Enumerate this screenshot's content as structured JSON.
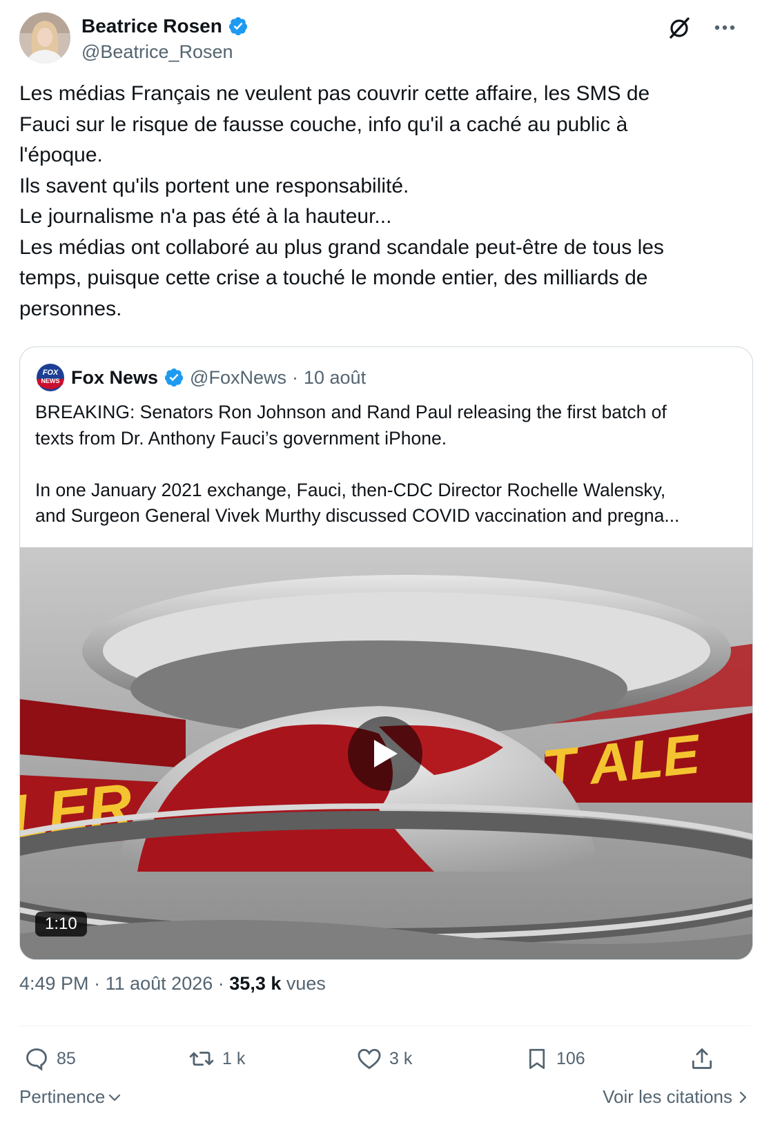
{
  "author": {
    "display_name": "Beatrice Rosen",
    "handle": "@Beatrice_Rosen",
    "verified": true,
    "avatar_icon": "profile-photo"
  },
  "tweet": {
    "text": "Les médias Français ne veulent pas couvrir cette affaire, les SMS de\nFauci sur le risque de fausse couche, info qu'il a caché au public à\nl'époque.\nIls savent qu'ils portent une responsabilité.\nLe journalisme n'a pas été à la hauteur...\nLes médias ont collaboré au plus grand scandale peut-être de tous les\ntemps, puisque cette crise a touché le monde entier, des milliards de\npersonnes."
  },
  "quoted": {
    "display_name": "Fox News",
    "handle": "@FoxNews",
    "separator": "·",
    "date": "10 août",
    "verified": true,
    "logo_icon": "fox-news-logo",
    "text": "BREAKING: Senators Ron Johnson and Rand Paul releasing the first batch of\ntexts from Dr. Anthony Fauci’s government iPhone.\n\nIn one January 2021 exchange, Fauci, then-CDC Director Rochelle Walensky,\nand Surgeon General Vivek Murthy discussed COVID vaccination and pregna...",
    "video": {
      "duration": "1:10",
      "overlay_text_left": "LER",
      "overlay_text_right": "T ALE",
      "play_icon": "play-icon"
    }
  },
  "meta": {
    "time": "4:49 PM",
    "sep1": "·",
    "date": "11 août 2026",
    "sep2": "·",
    "views_count": "35,3 k",
    "views_label": "vues"
  },
  "actions": {
    "replies": "85",
    "reposts": "1 k",
    "likes": "3 k",
    "bookmarks": "106"
  },
  "footer": {
    "sort_label": "Pertinence",
    "quotes_link": "Voir les citations"
  },
  "colors": {
    "verified_blue": "#1d9bf0",
    "secondary_text": "#536471",
    "primary_text": "#0f1419",
    "border": "#cfd9de"
  }
}
